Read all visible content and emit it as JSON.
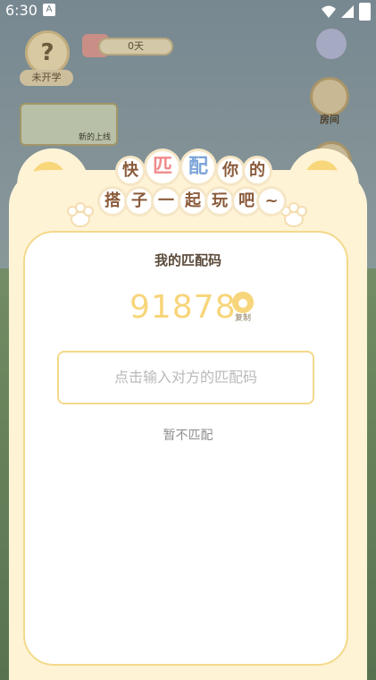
{
  "status_bar": {
    "time": "6:30"
  },
  "hud": {
    "not_started_label": "未开学",
    "days_label": "0天",
    "room_label": "房间",
    "banner_label": "新的上线"
  },
  "modal": {
    "title_chars_line1": [
      "快",
      "匹",
      "配",
      "你",
      "的"
    ],
    "title_chars_line2": [
      "搭",
      "子",
      "一",
      "起",
      "玩",
      "吧",
      "~"
    ],
    "card_title": "我的匹配码",
    "match_code": "91878",
    "copy_label": "复制",
    "input_placeholder": "点击输入对方的匹配码",
    "skip_label": "暂不匹配"
  }
}
